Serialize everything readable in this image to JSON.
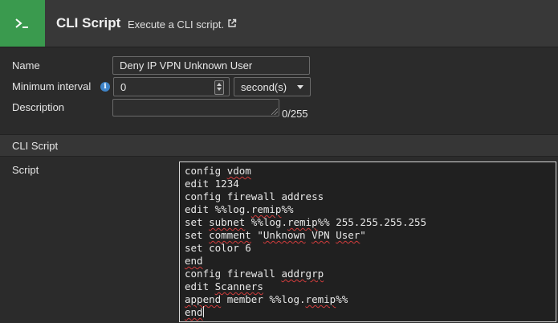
{
  "header": {
    "icon": "terminal-icon",
    "title": "CLI Script",
    "description": "Execute a CLI script.",
    "accent_color": "#3a9a4e"
  },
  "form": {
    "name_label": "Name",
    "name_value": "Deny IP VPN Unknown User",
    "interval_label": "Minimum interval",
    "interval_value": "0",
    "interval_unit": "second(s)",
    "description_label": "Description",
    "description_value": "",
    "description_count": "0/255"
  },
  "section": {
    "title": "CLI Script"
  },
  "script": {
    "label": "Script",
    "lines": [
      "config vdom",
      "edit 1234",
      "config firewall address",
      "edit %%log.remip%%",
      "set subnet %%log.remip%% 255.255.255.255",
      "set comment \"Unknown VPN User\"",
      "set color 6",
      "end",
      "config firewall addrgrp",
      "edit Scanners",
      "append member %%log.remip%%",
      "end"
    ]
  }
}
